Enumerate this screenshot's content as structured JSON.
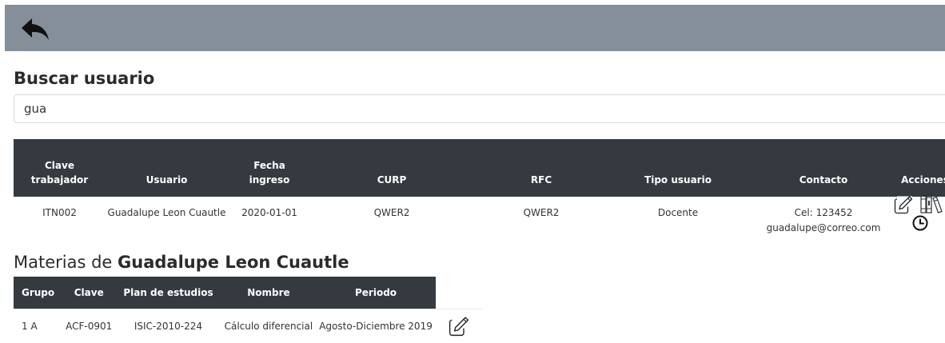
{
  "search": {
    "title": "Buscar usuario",
    "value": "gua"
  },
  "users_table": {
    "headers": {
      "clave_line1": "Clave",
      "clave_line2": "trabajador",
      "usuario": "Usuario",
      "fecha_line1": "Fecha",
      "fecha_line2": "ingreso",
      "curp": "CURP",
      "rfc": "RFC",
      "tipo": "Tipo usuario",
      "contacto": "Contacto",
      "acciones": "Acciones"
    },
    "rows": [
      {
        "clave": "ITN002",
        "usuario": "Guadalupe Leon Cuautle",
        "fecha": "2020-01-01",
        "curp": "QWER2",
        "rfc": "QWER2",
        "tipo": "Docente",
        "cel": "Cel: 123452",
        "email": "guadalupe@correo.com"
      }
    ]
  },
  "materias": {
    "prefix": "Materias de ",
    "user_name": "Guadalupe Leon Cuautle",
    "headers": {
      "grupo": "Grupo",
      "clave": "Clave",
      "plan": "Plan de estudios",
      "nombre": "Nombre",
      "periodo": "Periodo"
    },
    "rows": [
      {
        "grupo": "1 A",
        "clave": "ACF-0901",
        "plan": "ISIC-2010-224",
        "nombre": "Cálculo diferencial",
        "periodo": "Agosto-Diciembre 2019"
      }
    ]
  },
  "icons": {
    "back": "reply-arrow-icon",
    "edit": "pencil-square-icon",
    "books": "books-icon",
    "clock": "clock-icon"
  },
  "colors": {
    "topbar": "#858f99",
    "table_header": "#343a40"
  }
}
